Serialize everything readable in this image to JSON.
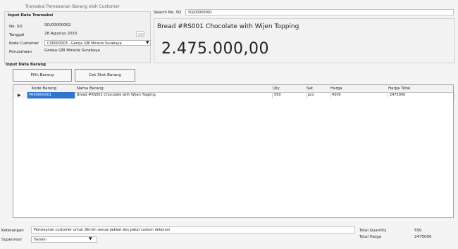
{
  "window": {
    "cut_title": "Transaksi Pemesanan Barang oleh Customer"
  },
  "transaction": {
    "title": "Input Data Transaksi",
    "no_so_label": "No. SO",
    "no_so_value": "SO/00000002",
    "tanggal_label": "Tanggal",
    "tanggal_value": "28   Agustus   2015",
    "kode_customer_label": "Kode Customer",
    "kode_customer_value": "C00000003 - Gereja GBI Miracle Surabaya",
    "perusahaan_label": "Perusahaan",
    "perusahaan_value": "Gereja GBI Miracle Surabaya"
  },
  "search": {
    "label": "Search No. SO",
    "value": "SO/00000001"
  },
  "product": {
    "title": "Bread #RS001 Chocolate with Wijen Topping",
    "price": "2.475.000,00"
  },
  "items": {
    "title": "Input Data Barang",
    "pilih_barang_label": "Pilih Barang",
    "cek_stok_label": "Cek Stok Barang",
    "columns": [
      "Kode Barang",
      "Nama Barang",
      "Qty",
      "Sat",
      "Harga",
      "Harga Total"
    ],
    "rows": [
      {
        "kode": "PR00000001",
        "nama": "Bread #RS001 Chocolate with Wijen Topping",
        "qty": "550",
        "sat": "pcs",
        "harga": "4500",
        "total": "2475000"
      }
    ]
  },
  "footer": {
    "keterangan_label": "Keterangan",
    "keterangan_value": "Pemesanan customer untuk dikirim sesuai jadwal dan pakai custom dekorasi",
    "supervisor_label": "Supervisor",
    "supervisor_value": "Hamim",
    "total_qty_label": "Total Quantity",
    "total_qty_value": "550",
    "total_harga_label": "Total Harga",
    "total_harga_value": "2475000"
  }
}
